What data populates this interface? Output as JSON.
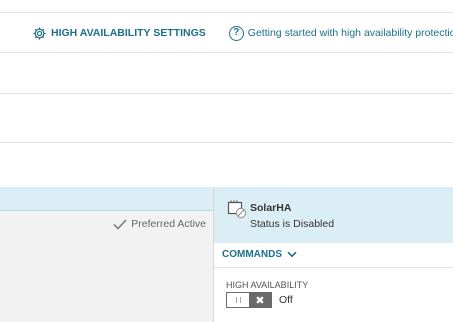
{
  "header": {
    "settings_label": "HIGH AVAILABILITY SETTINGS",
    "help_label": "Getting started with high availability protection",
    "settings_icon": "gear-icon",
    "help_icon": "help-circle-icon",
    "help_glyph": "?"
  },
  "pool": {
    "preferred_label": "Preferred Active",
    "preferred_icon": "checkmark-icon"
  },
  "node": {
    "name": "SolarHA",
    "status": "Status is Disabled",
    "icon": "server-disabled-icon"
  },
  "commands": {
    "label": "COMMANDS",
    "icon": "chevron-down-icon"
  },
  "high_availability": {
    "label": "HIGH AVAILABILITY",
    "toggle_glyph": "✖",
    "state": "Off",
    "enabled": false
  },
  "colors": {
    "accent": "#1d6f8a",
    "header_bg": "#dceef5",
    "panel_bg": "#f2f2f2",
    "toggle_dark": "#6a6a6a"
  }
}
